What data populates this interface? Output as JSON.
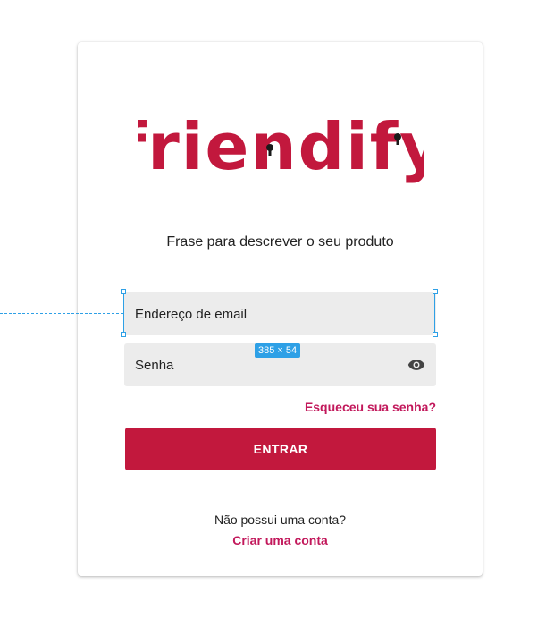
{
  "brand": {
    "name": "friendify",
    "color": "#c2183d"
  },
  "tagline": "Frase para descrever o seu produto",
  "form": {
    "email_placeholder": "Endereço de email",
    "password_placeholder": "Senha",
    "show_password_icon": "eye-icon",
    "forgot_link": "Esqueceu sua senha?",
    "submit_label": "ENTRAR"
  },
  "signup": {
    "prompt": "Não possui uma conta?",
    "link": "Criar uma conta"
  },
  "design_overlay": {
    "selection_size_label": "385 × 54",
    "guide_color": "#2ea0e6"
  }
}
